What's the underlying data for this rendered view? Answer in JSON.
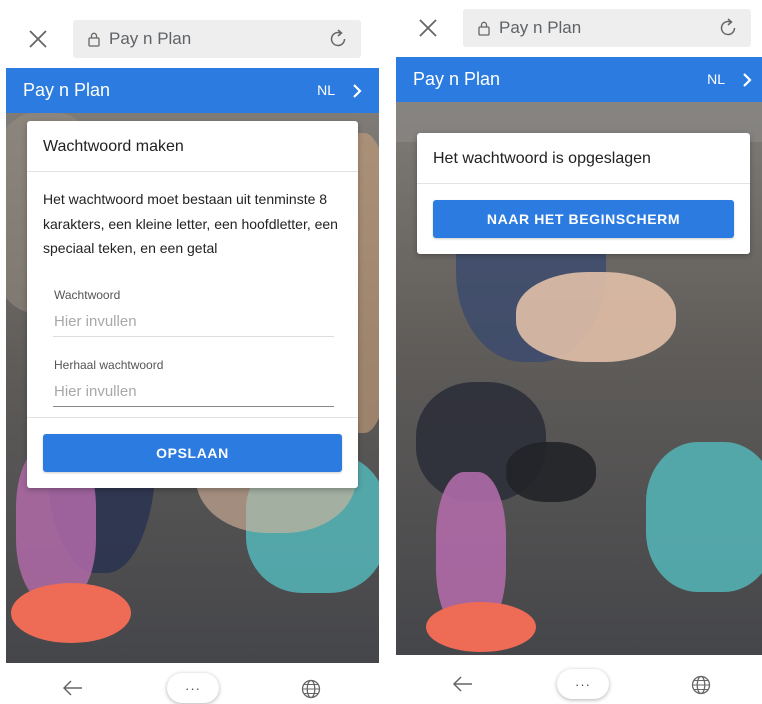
{
  "browser": {
    "url": "Pay n Plan"
  },
  "app": {
    "title": "Pay n Plan",
    "language": "NL"
  },
  "create_password": {
    "title": "Wachtwoord maken",
    "description": "Het wachtwoord moet bestaan uit tenminste 8 karakters, een kleine letter, een hoofdletter, een speciaal teken, en een getal",
    "password_label": "Wachtwoord",
    "password_placeholder": "Hier invullen",
    "repeat_label": "Herhaal wachtwoord",
    "repeat_placeholder": "Hier invullen",
    "save_button": "OPSLAAN"
  },
  "password_saved": {
    "message": "Het wachtwoord is opgeslagen",
    "home_button": "NAAR HET BEGINSCHERM"
  },
  "bottom_nav": {
    "more_label": "···"
  },
  "icons": {
    "close": "close-icon",
    "lock": "lock-icon",
    "reload": "reload-icon",
    "next": "chevron-right-icon",
    "back": "back-arrow-icon",
    "globe": "globe-icon"
  },
  "colors": {
    "primary": "#2c7be0",
    "url_bar": "#eeeeee",
    "card": "#ffffff"
  }
}
